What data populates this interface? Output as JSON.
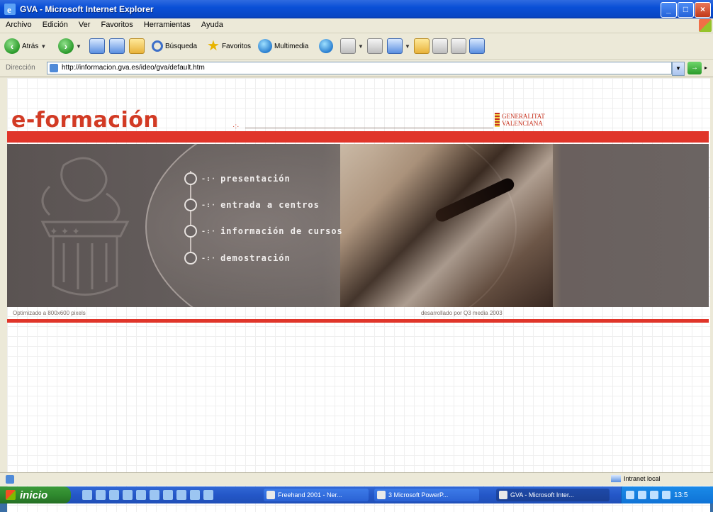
{
  "window": {
    "title": "GVA - Microsoft Internet Explorer"
  },
  "menu": [
    "Archivo",
    "Edición",
    "Ver",
    "Favoritos",
    "Herramientas",
    "Ayuda"
  ],
  "toolbar": {
    "back": "Atrás",
    "search": "Búsqueda",
    "favorites": "Favoritos",
    "multimedia": "Multimedia"
  },
  "address": {
    "label": "Dirección",
    "url": "http://informacion.gva.es/ideo/gva/default.htm"
  },
  "page": {
    "logo": "e-formación",
    "gv_line1": "GENERALITAT",
    "gv_line2": "VALENCIANA",
    "nav": [
      "presentación",
      "entrada a centros",
      "información de cursos",
      "demostración"
    ],
    "footer_left": "Optimizado a 800x600 pixels",
    "footer_right": "desarrollado por Q3 media 2003"
  },
  "status": {
    "zone": "Intranet local"
  },
  "taskbar": {
    "start": "inicio",
    "tasks": [
      "Freehand 2001 - Ner...",
      "3 Microsoft PowerP...",
      "GVA - Microsoft Inter..."
    ],
    "clock": "13:5"
  },
  "colors": {
    "accent": "#e0352a",
    "title_bar": "#0a4fd6",
    "banner": "#6b6463"
  }
}
